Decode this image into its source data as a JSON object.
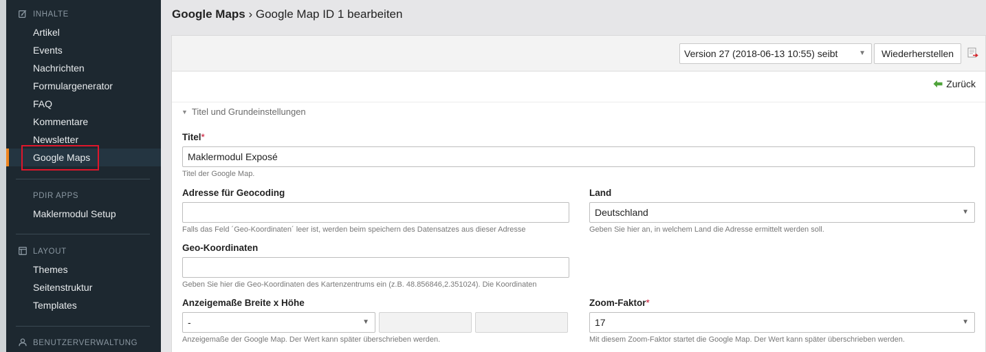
{
  "sidebar": {
    "groups": [
      {
        "title": "INHALTE",
        "icon": "edit-icon",
        "items": [
          "Artikel",
          "Events",
          "Nachrichten",
          "Formulargenerator",
          "FAQ",
          "Kommentare",
          "Newsletter",
          "Google Maps"
        ]
      },
      {
        "title": "PDIR APPS",
        "items": [
          "Maklermodul Setup"
        ]
      },
      {
        "title": "LAYOUT",
        "icon": "layout-icon",
        "items": [
          "Themes",
          "Seitenstruktur",
          "Templates"
        ]
      },
      {
        "title": "BENUTZERVERWALTUNG",
        "icon": "user-icon",
        "items": []
      }
    ],
    "active_item": "Google Maps",
    "accent_color": "#f0851f",
    "highlight_color": "#e0162b"
  },
  "header": {
    "breadcrumb_root": "Google Maps",
    "separator": "›",
    "breadcrumb_current": "Google Map ID 1 bearbeiten"
  },
  "toolbar": {
    "version_select": "Version 27 (2018-06-13 10:55) seibt",
    "restore_button": "Wiederherstellen",
    "diff_icon": "diff-icon"
  },
  "back_link": "Zurück",
  "fieldset": {
    "legend": "Titel und Grundeinstellungen"
  },
  "form": {
    "title": {
      "label": "Titel",
      "required": "*",
      "value": "Maklermodul Exposé",
      "help": "Titel der Google Map."
    },
    "geocoding": {
      "label": "Adresse für Geocoding",
      "value": "",
      "help": "Falls das Feld ´Geo-Koordinaten´ leer ist, werden beim speichern des Datensatzes aus dieser Adresse"
    },
    "country": {
      "label": "Land",
      "value": "Deutschland",
      "help": "Geben Sie hier an, in welchem Land die Adresse ermittelt werden soll."
    },
    "geo_coords": {
      "label": "Geo-Koordinaten",
      "value": "",
      "help": "Geben Sie hier die Geo-Koordinaten des Kartenzentrums ein (z.B. 48.856846,2.351024). Die Koordinaten"
    },
    "dimensions": {
      "label": "Anzeigemaße Breite x Höhe",
      "unit_value": "-",
      "help": "Anzeigemaße der Google Map. Der Wert kann später überschrieben werden."
    },
    "zoom": {
      "label": "Zoom-Faktor",
      "required": "*",
      "value": "17",
      "help": "Mit diesem Zoom-Faktor startet die Google Map. Der Wert kann später überschrieben werden."
    }
  }
}
